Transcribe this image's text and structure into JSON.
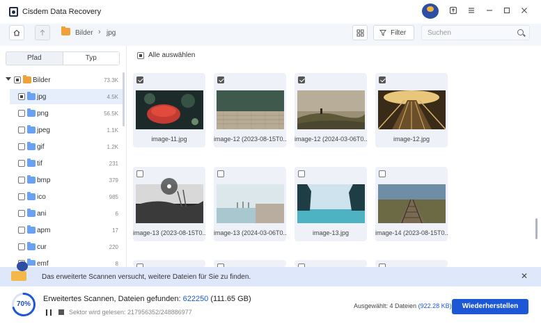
{
  "app": {
    "title": "Cisdem Data Recovery"
  },
  "breadcrumb": {
    "root": "Bilder",
    "current": "jpg",
    "separator": "›"
  },
  "toolbar": {
    "filter_label": "Filter",
    "search_placeholder": "Suchen"
  },
  "sidebar": {
    "tabs": [
      {
        "label": "Pfad"
      },
      {
        "label": "Typ"
      }
    ],
    "root": {
      "label": "Bilder",
      "count": "73.3K"
    },
    "items": [
      {
        "label": "jpg",
        "count": "4.5K"
      },
      {
        "label": "png",
        "count": "56.5K"
      },
      {
        "label": "jpeg",
        "count": "1.1K"
      },
      {
        "label": "gif",
        "count": "1.2K"
      },
      {
        "label": "tif",
        "count": "231"
      },
      {
        "label": "bmp",
        "count": "379"
      },
      {
        "label": "ico",
        "count": "985"
      },
      {
        "label": "ani",
        "count": "6"
      },
      {
        "label": "apm",
        "count": "17"
      },
      {
        "label": "cur",
        "count": "220"
      },
      {
        "label": "emf",
        "count": "8"
      }
    ]
  },
  "main": {
    "select_all_label": "Alle auswählen",
    "files": [
      {
        "name": "image-11.jpg",
        "checked": true
      },
      {
        "name": "image-12 (2023-08-15T0...",
        "checked": true
      },
      {
        "name": "image-12 (2024-03-06T0...",
        "checked": true
      },
      {
        "name": "image-12.jpg",
        "checked": true
      },
      {
        "name": "image-13 (2023-08-15T0...",
        "checked": false
      },
      {
        "name": "image-13 (2024-03-06T0...",
        "checked": false
      },
      {
        "name": "image-13.jpg",
        "checked": false
      },
      {
        "name": "image-14 (2023-08-15T0...",
        "checked": false
      }
    ]
  },
  "notice": {
    "text": "Das erweiterte Scannen versucht, weitere Dateien für Sie zu finden."
  },
  "status": {
    "progress_percent": 70,
    "progress_label": "70%",
    "scan_prefix": "Erweitertes Scannen, Dateien gefunden:",
    "files_found": "622250",
    "size_found": "(111.65 GB)",
    "sector_text": "Sektor wird gelesen: 217956352/248886977",
    "selected_prefix": "Ausgewählt: 4 Dateien",
    "selected_size": "(922.28 KB)",
    "recover_label": "Wiederherstellen"
  },
  "colors": {
    "accent": "#1c57d6",
    "notice_bg": "#dfe7fa",
    "folder_blue": "#6aa1f3",
    "folder_orange": "#f0a13a"
  }
}
